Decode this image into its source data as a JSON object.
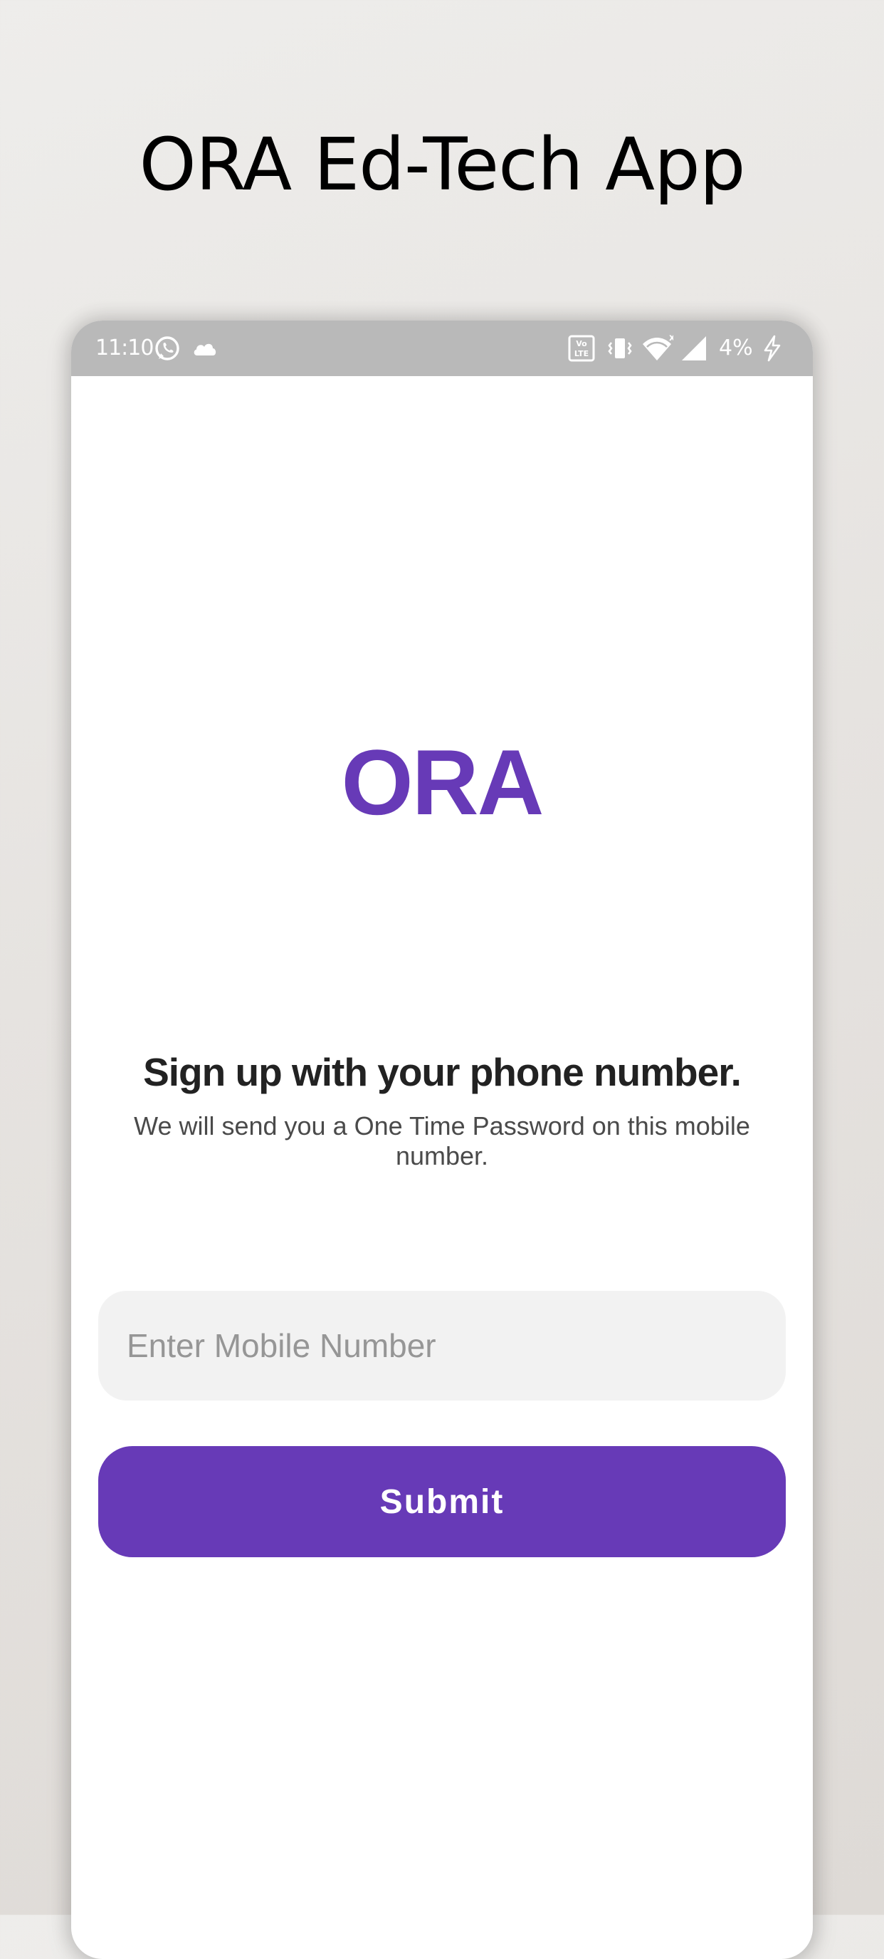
{
  "page": {
    "heading": "ORA Ed-Tech App"
  },
  "status_bar": {
    "time": "11:10",
    "battery_percent": "4%",
    "left_icons": [
      "whatsapp-icon",
      "cloud-icon"
    ],
    "right_icons": [
      "volte-icon",
      "vibrate-icon",
      "wifi-icon",
      "signal-icon",
      "charging-icon"
    ]
  },
  "app": {
    "logo_text": "ORA",
    "brand_color": "#673ab7",
    "signup": {
      "title": "Sign up with your phone number.",
      "subtitle": "We will send you a One Time Password on this mobile number."
    },
    "mobile_input": {
      "value": "",
      "placeholder": "Enter Mobile Number"
    },
    "submit_label": "Submit"
  }
}
